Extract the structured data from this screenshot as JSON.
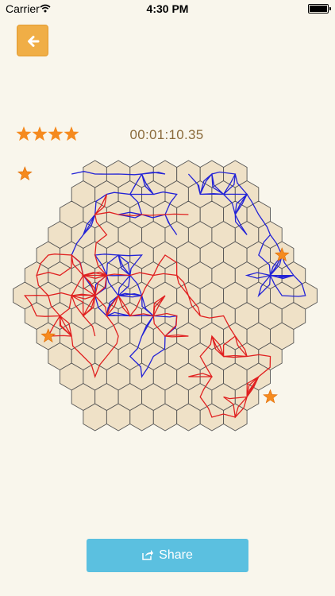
{
  "status_bar": {
    "carrier": "Carrier",
    "time": "4:30 PM"
  },
  "header": {
    "back_icon": "arrow-left-icon"
  },
  "game": {
    "stars_earned": 4,
    "stars_total": 4,
    "timer": "00:01:10.35",
    "board": {
      "radius": 6,
      "cell_fill": "#efe1c7",
      "cell_stroke": "#555555",
      "blue_path_color": "#2323d6",
      "red_path_color": "#e02020",
      "star_color": "#f58a1f",
      "target_star_count": 4
    }
  },
  "share": {
    "label": "Share",
    "icon": "share-icon"
  }
}
